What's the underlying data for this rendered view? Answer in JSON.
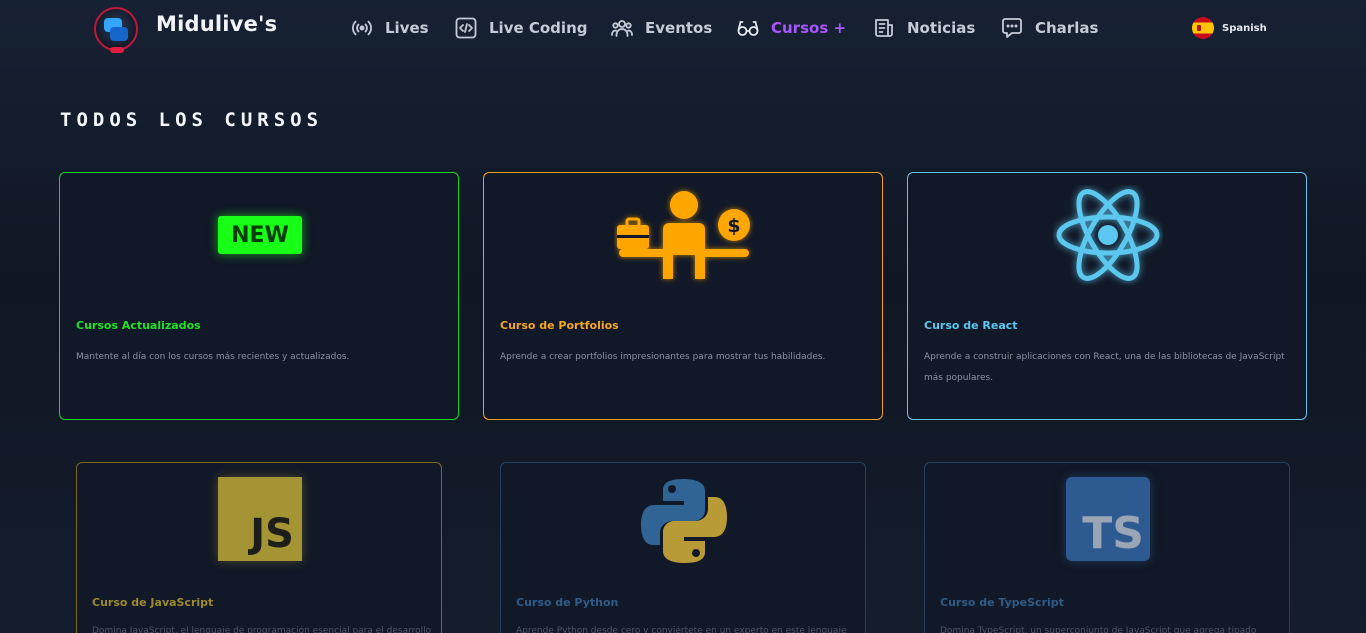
{
  "header": {
    "brand": "Midulive's",
    "nav": [
      {
        "label": "Lives",
        "icon": "broadcast-icon"
      },
      {
        "label": "Live Coding",
        "icon": "code-icon"
      },
      {
        "label": "Eventos",
        "icon": "users-icon"
      },
      {
        "label": "Cursos +",
        "icon": "glasses-icon",
        "active": true
      },
      {
        "label": "Noticias",
        "icon": "newspaper-icon"
      },
      {
        "label": "Charlas",
        "icon": "chat-icon"
      }
    ],
    "language": "Spanish",
    "active_color": "#a757ff"
  },
  "main": {
    "heading": "TODOS LOS CURSOS",
    "cards": [
      {
        "title": "Cursos Actualizados",
        "description": "Mantente al día con los cursos más recientes y actualizados.",
        "badge": "NEW",
        "accent": "#19d11f"
      },
      {
        "title": "Curso de Portfolios",
        "description": "Aprende a crear portfolios impresionantes para mostrar tus habilidades.",
        "accent": "#f5a01a"
      },
      {
        "title": "Curso de React",
        "description": "Aprende a construir aplicaciones con React, una de las bibliotecas de JavaScript más populares.",
        "accent": "#62c4e8"
      },
      {
        "title": "Curso de JavaScript",
        "description": "Domina JavaScript, el lenguaje de programación esencial para el desarrollo",
        "logo": "JS",
        "accent": "#a59433"
      },
      {
        "title": "Curso de Python",
        "description": "Aprende Python desde cero y conviértete en un experto en este lenguaje de",
        "accent": "#2f5c87"
      },
      {
        "title": "Curso de TypeScript",
        "description": "Domina TypeScript, un superconjunto de JavaScript que agrega tipado",
        "logo": "TS",
        "accent": "#2e5a92"
      }
    ]
  }
}
